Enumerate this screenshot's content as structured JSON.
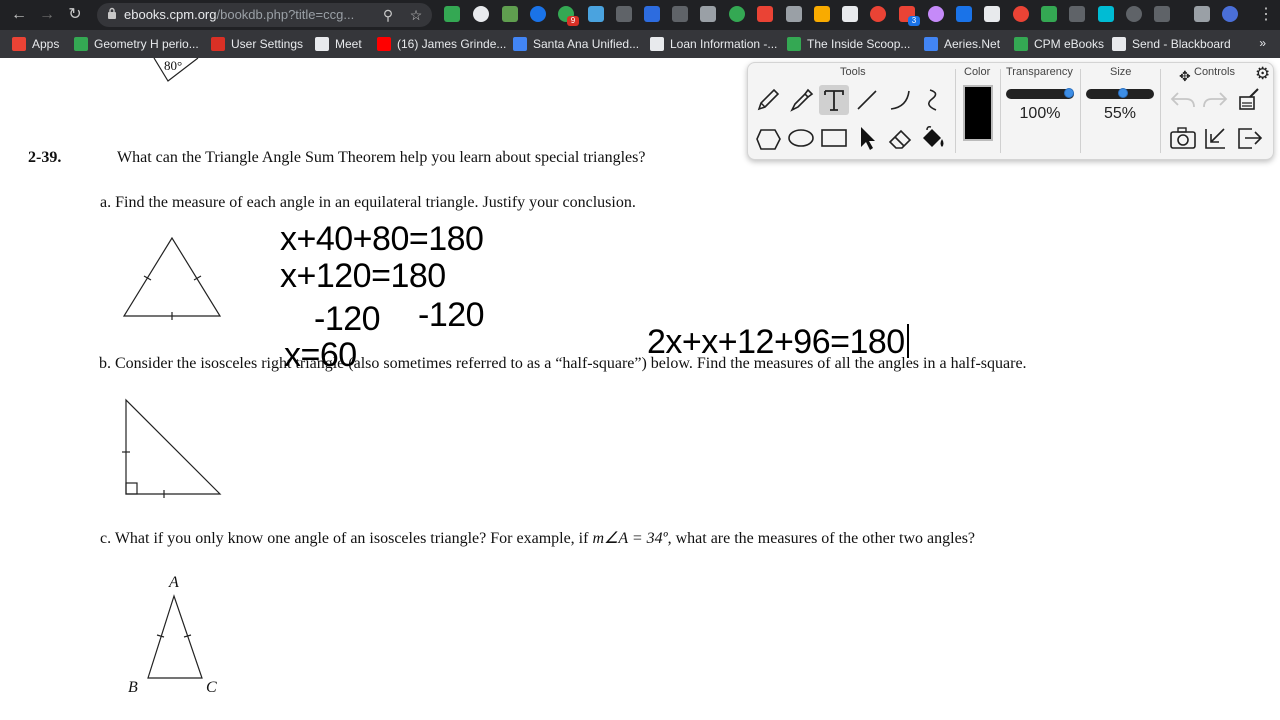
{
  "browser": {
    "url_host": "ebooks.cpm.org",
    "url_path": "/bookdb.php?title=ccg..."
  },
  "bookmarks": [
    {
      "label": "Apps",
      "color": "#ea4335"
    },
    {
      "label": "Geometry H perio...",
      "color": "#34a853"
    },
    {
      "label": "User Settings",
      "color": "#d93025"
    },
    {
      "label": "Meet",
      "color": "#e8eaed"
    },
    {
      "label": "(16) James Grinde...",
      "color": "#ff0000"
    },
    {
      "label": "Santa Ana Unified...",
      "color": "#4285f4"
    },
    {
      "label": "Loan Information -...",
      "color": "#e8eaed"
    },
    {
      "label": "The Inside Scoop...",
      "color": "#34a853"
    },
    {
      "label": "Aeries.Net",
      "color": "#4285f4"
    },
    {
      "label": "CPM eBooks",
      "color": "#34a853"
    },
    {
      "label": "Send - Blackboard",
      "color": "#e8eaed"
    }
  ],
  "bookmarks_more": "»",
  "extension_badges": {
    "b1": "9",
    "b2": "3"
  },
  "problem": {
    "fig_angle": "80°",
    "number": "2-39.",
    "question": "What can the Triangle Angle Sum Theorem help you learn about special triangles?",
    "part_a": "a. Find the measure of each angle in an equilateral triangle.  Justify your conclusion.",
    "part_b": "b. Consider the isosceles right triangle (also sometimes referred to as a “half-square”) below.  Find the measures of all the angles in a half-square.",
    "part_c_pre": "c. What if you only know one angle of an isosceles triangle? For example, if ",
    "part_c_math": "m∠A = 34º",
    "part_c_post": ", what are the measures of the other two angles?",
    "vertex_a": "A",
    "vertex_b": "B",
    "vertex_c": "C"
  },
  "annotations": {
    "line1": "x+40+80=180",
    "line2": "x+120=180",
    "line3a": "-120",
    "line3b": "-120",
    "line4": "x=60",
    "line5": "2x+x+12+96=180"
  },
  "palette": {
    "tools_title": "Tools",
    "color_title": "Color",
    "transparency_title": "Transparency",
    "size_title": "Size",
    "controls_title": "Controls",
    "transparency_value": "100%",
    "size_value": "55%",
    "transparency_level": 1.0,
    "size_level": 0.55,
    "selected_color": "#000000",
    "accent": "#3d8ee6"
  }
}
